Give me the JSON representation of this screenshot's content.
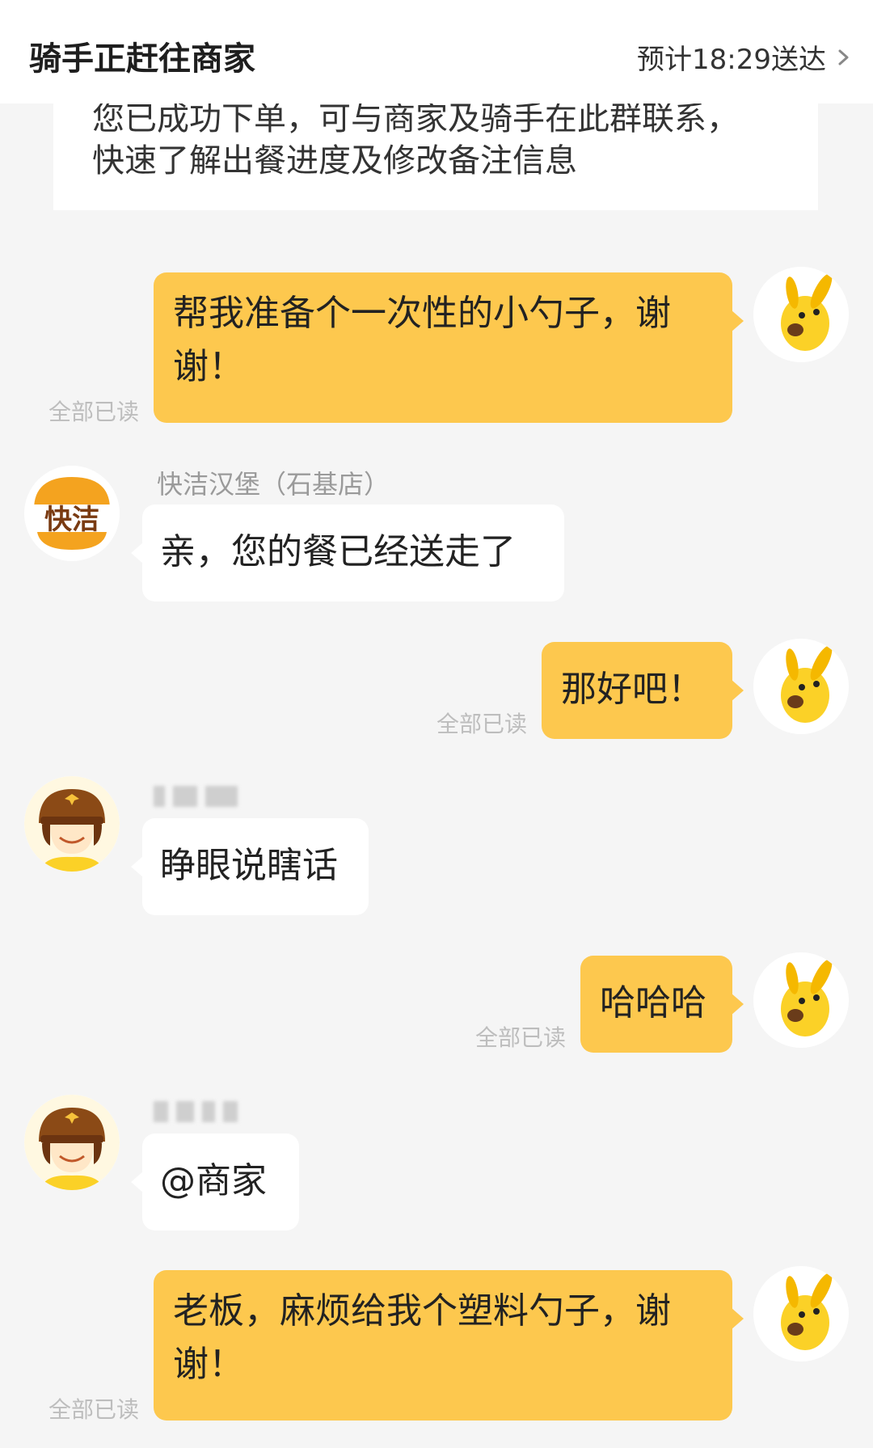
{
  "header": {
    "title": "骑手正赶往商家",
    "eta": "预计18:29送达"
  },
  "notice": {
    "line1": "您已成功下单，可与商家及骑手在此群联系，",
    "line2": "快速了解出餐进度及修改备注信息"
  },
  "messages": [
    {
      "side": "out",
      "lines": [
        "帮我准备个一次性的小勺子，谢",
        "谢！"
      ],
      "status": "全部已读"
    },
    {
      "side": "in",
      "sender": "快洁汉堡（石基店）",
      "avatar_text": "快洁",
      "lines": [
        "亲，您的餐已经送走了"
      ]
    },
    {
      "side": "out",
      "lines": [
        "那好吧！"
      ],
      "status": "全部已读"
    },
    {
      "side": "in",
      "sender": "",
      "sender_blurred": true,
      "lines": [
        "睁眼说瞎话"
      ]
    },
    {
      "side": "out",
      "lines": [
        "哈哈哈"
      ],
      "status": "全部已读"
    },
    {
      "side": "in",
      "sender": "",
      "sender_blurred": true,
      "lines": [
        "@商家"
      ]
    },
    {
      "side": "out",
      "lines": [
        "老板，麻烦给我个塑料勺子，谢",
        "谢！"
      ],
      "status": "全部已读"
    }
  ],
  "colors": {
    "outgoing_bubble": "#fdc84e",
    "incoming_bubble": "#ffffff",
    "background": "#f5f5f5"
  },
  "icons": {
    "user_avatar": "yellow-kangaroo-icon",
    "rider_avatar": "courier-rider-icon",
    "merchant_avatar": "burger-logo-icon",
    "eta_arrow": "chevron-right-icon"
  }
}
